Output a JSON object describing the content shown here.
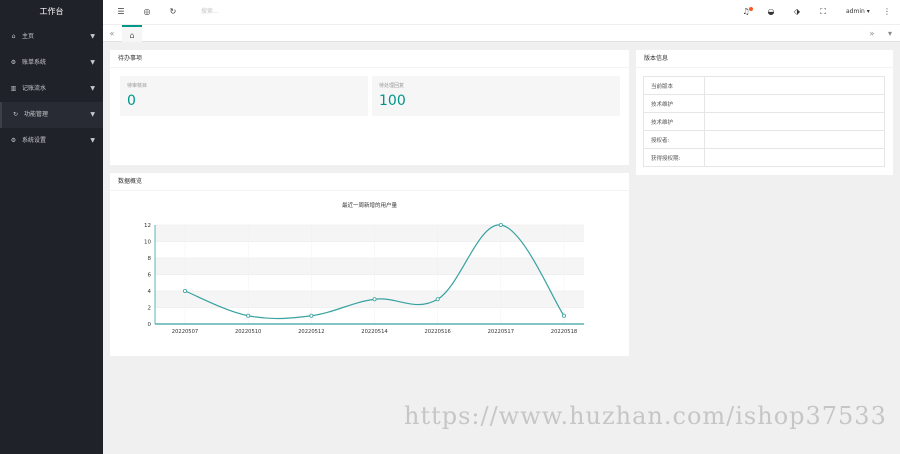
{
  "sidebar": {
    "logo": "工作台",
    "items": [
      {
        "label": "主页",
        "icon": "home-icon",
        "glyph": "⌂"
      },
      {
        "label": "账单系统",
        "icon": "gear-icon",
        "glyph": "⚙"
      },
      {
        "label": "记账流水",
        "icon": "bars-icon",
        "glyph": "▥"
      },
      {
        "label": "功能管理",
        "icon": "refresh-icon",
        "glyph": "↻"
      },
      {
        "label": "系统设置",
        "icon": "settings-icon",
        "glyph": "⚙"
      }
    ]
  },
  "topbar": {
    "search_placeholder": "搜索...",
    "user": "admin"
  },
  "todo": {
    "title": "待办事项",
    "cards": [
      {
        "label": "待审核目",
        "value": "0"
      },
      {
        "label": "待处理回复",
        "value": "100"
      }
    ]
  },
  "version": {
    "title": "版本信息",
    "rows": [
      {
        "key": "当前版本",
        "value": ""
      },
      {
        "key": "技术维护",
        "value": ""
      },
      {
        "key": "技术维护",
        "value": ""
      },
      {
        "key": "授权者:",
        "value": ""
      },
      {
        "key": "获得授权期:",
        "value": ""
      }
    ]
  },
  "overview": {
    "title": "数据概览"
  },
  "chart_data": {
    "type": "line",
    "title": "最近一周新增的用户量",
    "categories": [
      "20220507",
      "20220510",
      "20220512",
      "20220514",
      "20220516",
      "20220517",
      "20220518"
    ],
    "series": [
      {
        "values": [
          4,
          1,
          1,
          3,
          3,
          12,
          1
        ]
      }
    ],
    "ylim": [
      0,
      12
    ],
    "yticks": [
      0,
      2,
      4,
      6,
      8,
      10,
      12
    ],
    "color": "#37a2a0",
    "grid": true
  },
  "watermark": "https://www.huzhan.com/ishop37533",
  "colors": {
    "accent": "#009688",
    "sidebar": "#20222a",
    "badge": "#ff5722"
  }
}
